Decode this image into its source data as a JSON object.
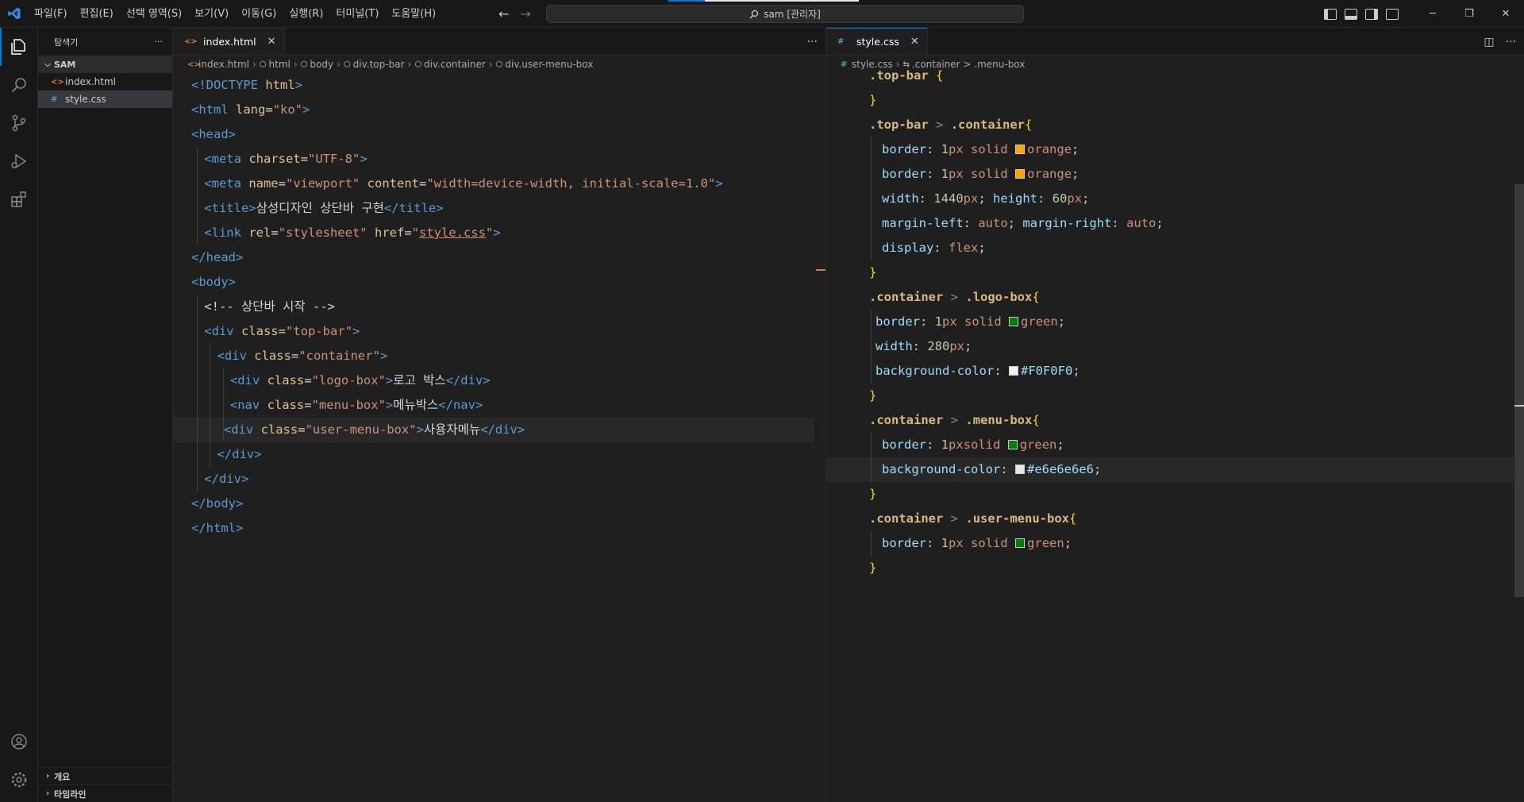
{
  "titlebar": {
    "menu": [
      "파일(F)",
      "편집(E)",
      "선택 영역(S)",
      "보기(V)",
      "이동(G)",
      "실행(R)",
      "터미널(T)",
      "도움말(H)"
    ],
    "search_text": "sam [관리자]"
  },
  "sidebar": {
    "title": "탐색기",
    "folder": "SAM",
    "files": [
      {
        "name": "index.html",
        "type": "html"
      },
      {
        "name": "style.css",
        "type": "css"
      }
    ],
    "bottom_sections": [
      "개요",
      "타임라인"
    ]
  },
  "left_editor": {
    "tab_label": "index.html",
    "breadcrumb": [
      "index.html",
      "html",
      "body",
      "div.top-bar",
      "div.container",
      "div.user-menu-box"
    ],
    "lines": [
      "<!DOCTYPE html>",
      "<html lang=\"ko\">",
      "<head>",
      "<meta charset=\"UTF-8\">",
      "<meta name=\"viewport\" content=\"width=device-width, initial-scale=1.0\">",
      "<title>삼성디자인 상단바 구현</title>",
      "<link rel=\"stylesheet\" href=\"style.css\">",
      "</head>",
      "<body>",
      "<!-- 상단바 시작 -->",
      "<div class=\"top-bar\">",
      "<div class=\"container\">",
      "<div class=\"logo-box\">로고 박스</div>",
      "<nav class=\"menu-box\">메뉴박스</nav>",
      "<div class=\"user-menu-box\">사용자메뉴</div>",
      "</div>",
      "</div>",
      "</body>",
      "</html>"
    ]
  },
  "right_editor": {
    "tab_label": "style.css",
    "breadcrumb": [
      "style.css",
      ".container > .menu-box"
    ],
    "lines": [
      ".top-bar {",
      "}",
      ".top-bar > .container{",
      "border: 1px solid orange;",
      "border: 1px solid orange;",
      "width: 1440px; height: 60px;",
      "margin-left: auto; margin-right: auto;",
      "display: flex;",
      "}",
      ".container > .logo-box{",
      "border: 1px solid green;",
      "width: 280px;",
      "background-color: #F0F0F0;",
      "}",
      ".container > .menu-box{",
      "border: 1pxsolid green;",
      "background-color: #e6e6e6e6;",
      "}",
      ".container > .user-menu-box{",
      "border: 1px solid green;",
      "}"
    ]
  },
  "colors": {
    "accent": "#0078d4",
    "orange_swatch": "#ffa500",
    "green_swatch": "#008000",
    "f0_swatch": "#f0f0f0",
    "e6_swatch": "#e6e6e6"
  }
}
